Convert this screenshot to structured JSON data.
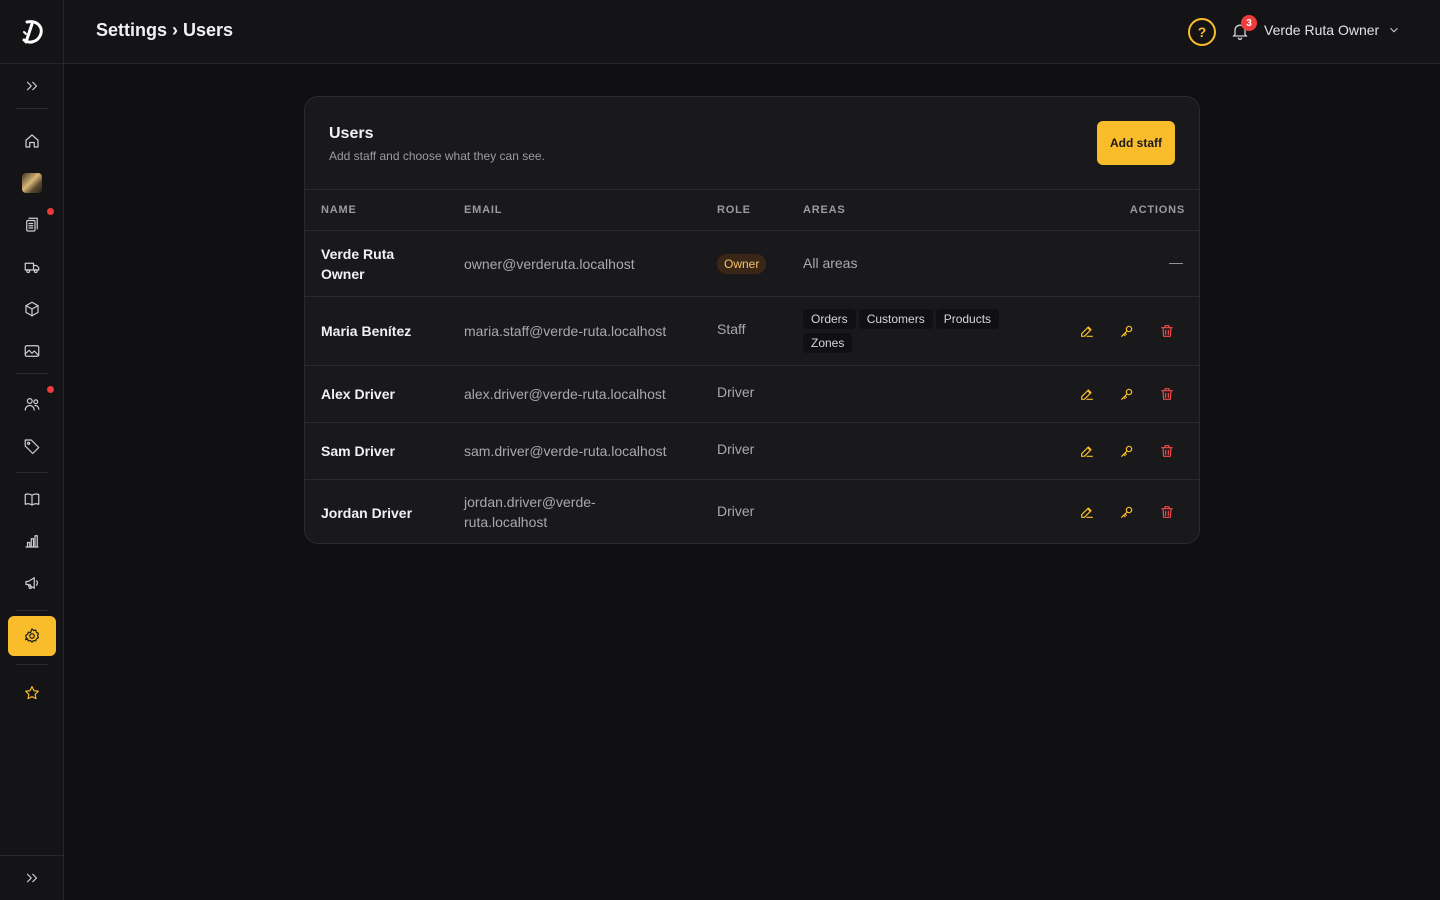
{
  "header": {
    "breadcrumb": "Settings › Users",
    "notification_count": "3",
    "user_name": "Verde Ruta Owner"
  },
  "sidebar": {
    "items": [
      {
        "icon": "chevrons-right-icon",
        "label": "Expand sidebar"
      },
      {
        "icon": "home-icon",
        "label": "Home"
      },
      {
        "icon": "store-thumbnail",
        "label": "Store"
      },
      {
        "icon": "clipboard-icon",
        "label": "Orders",
        "alert": true
      },
      {
        "icon": "truck-icon",
        "label": "Deliveries"
      },
      {
        "icon": "box-icon",
        "label": "Products"
      },
      {
        "icon": "image-icon",
        "label": "Media"
      },
      {
        "icon": "users-icon",
        "label": "Customers",
        "alert": true
      },
      {
        "icon": "tag-icon",
        "label": "Discounts"
      },
      {
        "icon": "book-icon",
        "label": "Catalog"
      },
      {
        "icon": "chart-icon",
        "label": "Analytics"
      },
      {
        "icon": "megaphone-icon",
        "label": "Marketing"
      },
      {
        "icon": "gear-icon",
        "label": "Settings",
        "active": true
      },
      {
        "icon": "star-icon",
        "label": "Favorites"
      }
    ]
  },
  "card": {
    "title": "Users",
    "subtitle": "Add staff and choose what they can see.",
    "add_button": "Add staff"
  },
  "table": {
    "headers": {
      "name": "NAME",
      "email": "EMAIL",
      "role": "ROLE",
      "areas": "AREAS",
      "actions": "ACTIONS"
    },
    "rows": [
      {
        "name": "Verde Ruta Owner",
        "email": "owner@verderuta.localhost",
        "role": "Owner",
        "areas_text": "All areas",
        "actions": "—"
      },
      {
        "name": "Maria Benítez",
        "email": "maria.staff@verde-ruta.localhost",
        "role": "Staff",
        "areas": [
          "Orders",
          "Customers",
          "Products",
          "Zones"
        ]
      },
      {
        "name": "Alex Driver",
        "email": "alex.driver@verde-ruta.localhost",
        "role": "Driver"
      },
      {
        "name": "Sam Driver",
        "email": "sam.driver@verde-ruta.localhost",
        "role": "Driver"
      },
      {
        "name": "Jordan Driver",
        "email": "jordan.driver@verde-ruta.localhost",
        "role": "Driver"
      }
    ]
  },
  "colors": {
    "accent": "#f9bd2b",
    "danger": "#ef4b4b",
    "background": "#0f0f11",
    "surface": "#19191c"
  }
}
